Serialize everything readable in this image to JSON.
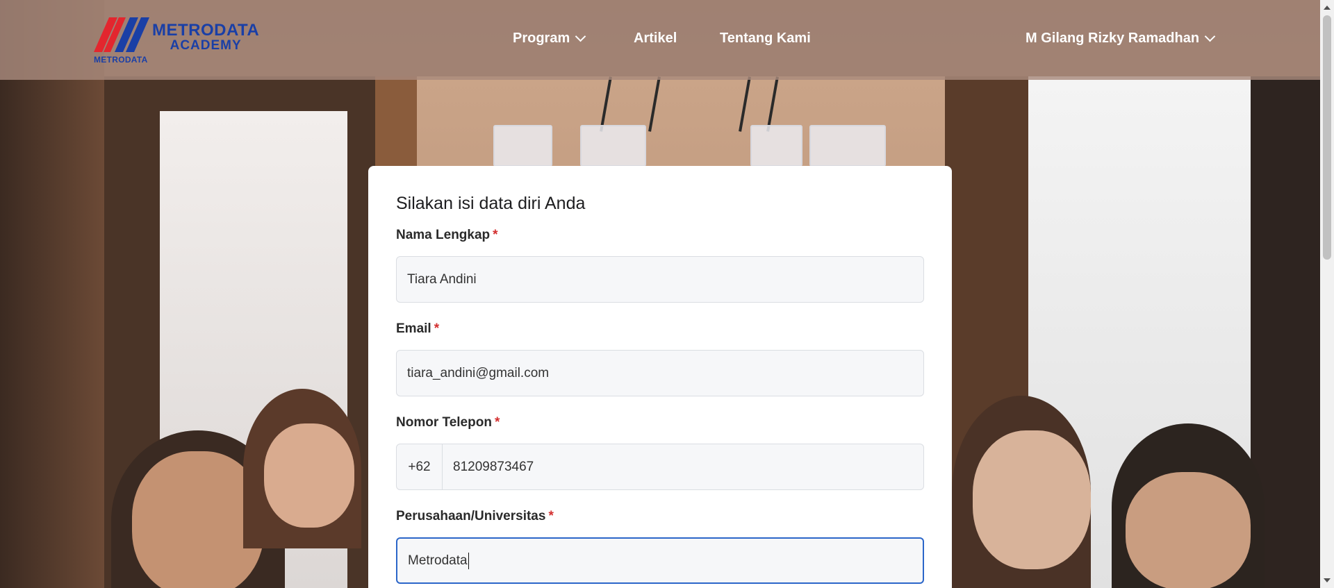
{
  "header": {
    "logo": {
      "name_line1": "METRODATA",
      "name_line2": "ACADEMY",
      "mark_caption": "METRODATA",
      "colors": {
        "primary": "#1a3fa6",
        "accent": "#e3262e"
      }
    },
    "nav": [
      {
        "label": "Program",
        "has_dropdown": true
      },
      {
        "label": "Artikel",
        "has_dropdown": false
      },
      {
        "label": "Tentang Kami",
        "has_dropdown": false
      }
    ],
    "user": {
      "name": "M Gilang Rizky Ramadhan",
      "has_dropdown": true
    }
  },
  "form": {
    "title": "Silakan isi data diri Anda",
    "required_marker": "*",
    "fields": {
      "full_name": {
        "label": "Nama Lengkap",
        "value": "Tiara Andini"
      },
      "email": {
        "label": "Email",
        "value": "tiara_andini@gmail.com"
      },
      "phone": {
        "label": "Nomor Telepon",
        "prefix": "+62",
        "value": "81209873467"
      },
      "company": {
        "label": "Perusahaan/Universitas",
        "value": "Metrodata"
      }
    }
  },
  "theme": {
    "focus_border": "#2b66c9",
    "required_color": "#d32f2f",
    "input_bg": "#f6f7f9"
  }
}
